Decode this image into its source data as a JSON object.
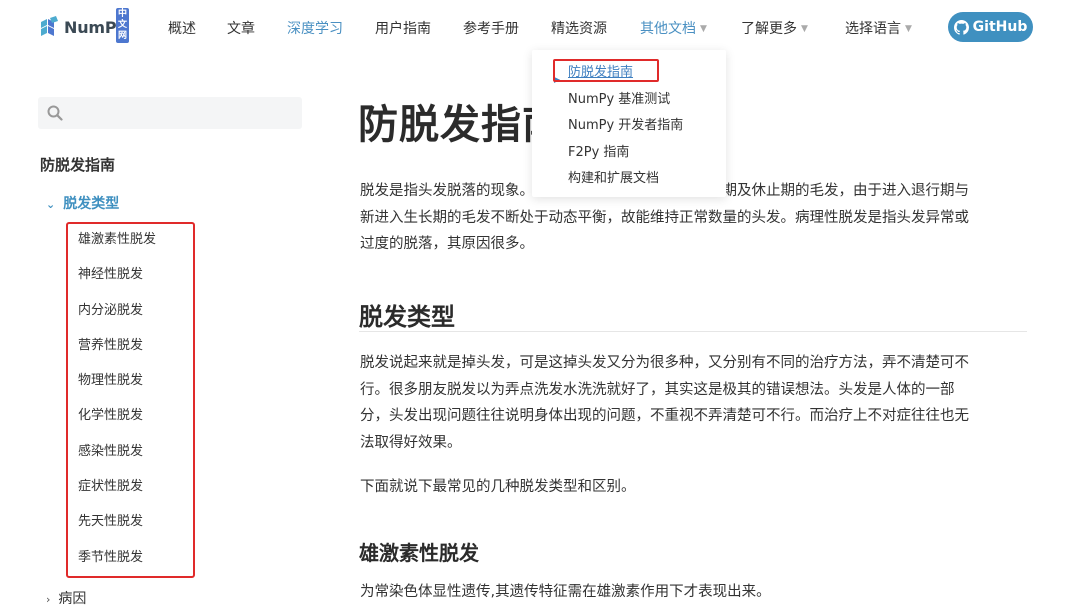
{
  "nav": {
    "logo_text": "NumPy",
    "logo_badge": "中文网",
    "items": [
      {
        "label": "概述",
        "active": false,
        "dropdown": false
      },
      {
        "label": "文章",
        "active": false,
        "dropdown": false
      },
      {
        "label": "深度学习",
        "active": true,
        "dropdown": false
      },
      {
        "label": "用户指南",
        "active": false,
        "dropdown": false
      },
      {
        "label": "参考手册",
        "active": false,
        "dropdown": false
      },
      {
        "label": "精选资源",
        "active": false,
        "dropdown": false
      },
      {
        "label": "其他文档",
        "active": true,
        "dropdown": true
      },
      {
        "label": "了解更多",
        "active": false,
        "dropdown": true
      },
      {
        "label": "选择语言",
        "active": false,
        "dropdown": true
      }
    ],
    "github_label": "GitHub"
  },
  "dropdown": {
    "items": [
      {
        "label": "防脱发指南",
        "active": true
      },
      {
        "label": "NumPy 基准测试",
        "active": false
      },
      {
        "label": "NumPy 开发者指南",
        "active": false
      },
      {
        "label": "F2Py 指南",
        "active": false
      },
      {
        "label": "构建和扩展文档",
        "active": false
      }
    ]
  },
  "sidebar": {
    "search_placeholder": "",
    "title": "防脱发指南",
    "section_label": "脱发类型",
    "section_chevron": "⌄",
    "sub_items": [
      "雄激素性脱发",
      "神经性脱发",
      "内分泌脱发",
      "营养性脱发",
      "物理性脱发",
      "化学性脱发",
      "感染性脱发",
      "症状性脱发",
      "先天性脱发",
      "季节性脱发"
    ],
    "next_label": "病因",
    "next_chevron": "›"
  },
  "main": {
    "title": "防脱发指南",
    "intro_lines": [
      "脱发是指头发脱落的现象。正常脱落的头发都是处于退行期及休止期的毛发，由于进入退行期与",
      "新进入生长期的毛发不断处于动态平衡，故能维持正常数量的头发。病理性脱发是指头发异常或",
      "过度的脱落，其原因很多。"
    ],
    "h2": "脱发类型",
    "para2_lines": [
      "脱发说起来就是掉头发，可是这掉头发又分为很多种，又分别有不同的治疗方法，弄不清楚可不",
      "行。很多朋友脱发以为弄点洗发水洗洗就好了，其实这是极其的错误想法。头发是人体的一部",
      "分，头发出现问题往往说明身体出现的问题，不重视不弄清楚可不行。而治疗上不对症往往也无",
      "法取得好效果。"
    ],
    "para3": "下面就说下最常见的几种脱发类型和区别。",
    "h3": "雄激素性脱发",
    "para4": "为常染色体显性遗传,其遗传特征需在雄激素作用下才表现出来。"
  },
  "colors": {
    "accent": "#3f90c0",
    "link_active": "#3f7fc0",
    "highlight_red": "#e02a2a"
  }
}
